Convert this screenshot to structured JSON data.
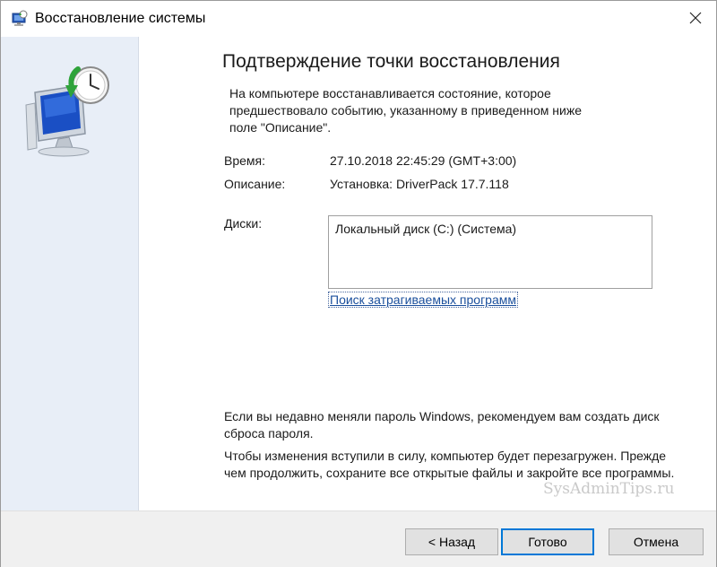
{
  "window": {
    "title": "Восстановление системы"
  },
  "main": {
    "heading": "Подтверждение точки восстановления",
    "intro": "На компьютере восстанавливается состояние, которое предшествовало событию, указанному в приведенном ниже поле \"Описание\".",
    "time_label": "Время:",
    "time_value": "27.10.2018 22:45:29 (GMT+3:00)",
    "description_label": "Описание:",
    "description_value": "Установка: DriverPack 17.7.118",
    "disks_label": "Диски:",
    "disks": [
      "Локальный диск (C:) (Система)"
    ],
    "scan_link": "Поиск затрагиваемых программ",
    "password_note": "Если вы недавно меняли пароль Windows, рекомендуем вам создать диск сброса пароля.",
    "restart_note": "Чтобы изменения вступили в силу, компьютер будет перезагружен. Прежде чем продолжить, сохраните все открытые файлы и закройте все программы."
  },
  "footer": {
    "back_label": "< Назад",
    "finish_label": "Готово",
    "cancel_label": "Отмена"
  },
  "watermark": "SysAdminTips.ru",
  "colors": {
    "sidebar": "#e8eef7",
    "link": "#1a4f9c",
    "default_button_border": "#0078d7"
  },
  "icons": [
    "system-restore-icon",
    "close-icon",
    "system-restore-hero-icon"
  ]
}
